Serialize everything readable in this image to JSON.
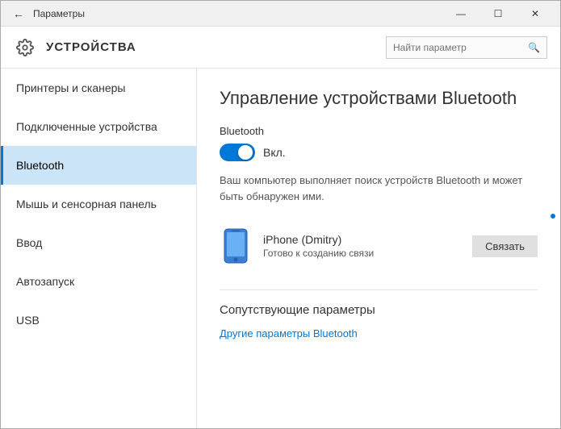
{
  "window": {
    "title": "Параметры",
    "controls": {
      "minimize": "—",
      "maximize": "☐",
      "close": "✕"
    }
  },
  "header": {
    "icon": "⚙",
    "title": "УСТРОЙСТВА",
    "search_placeholder": "Найти параметр",
    "search_icon": "🔍"
  },
  "sidebar": {
    "items": [
      {
        "label": "Принтеры и сканеры",
        "active": false
      },
      {
        "label": "Подключенные устройства",
        "active": false
      },
      {
        "label": "Bluetooth",
        "active": true
      },
      {
        "label": "Мышь и сенсорная панель",
        "active": false
      },
      {
        "label": "Ввод",
        "active": false
      },
      {
        "label": "Автозапуск",
        "active": false
      },
      {
        "label": "USB",
        "active": false
      }
    ]
  },
  "main": {
    "title": "Управление устройствами Bluetooth",
    "bluetooth_label": "Bluetooth",
    "toggle_state": "Вкл.",
    "info_text": "Ваш компьютер выполняет поиск устройств Bluetooth и может быть обнаружен ими.",
    "device": {
      "name": "iPhone (Dmitry)",
      "status": "Готово к созданию связи",
      "connect_button": "Связать"
    },
    "related_title": "Сопутствующие параметры",
    "related_link": "Другие параметры Bluetooth"
  }
}
